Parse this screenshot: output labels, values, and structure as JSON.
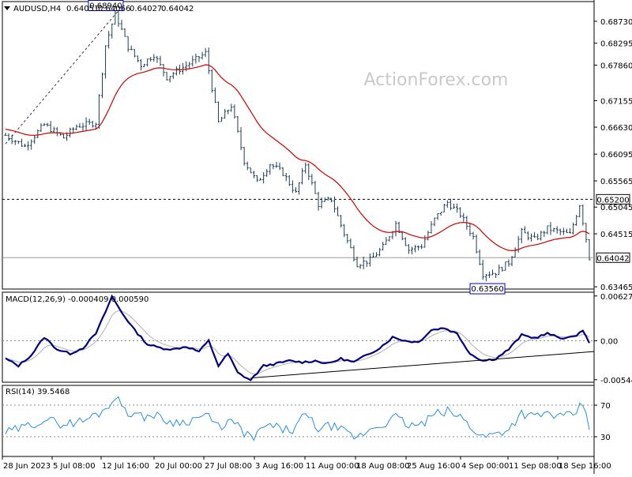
{
  "chart_data": [
    {
      "panel": "price",
      "type": "bar",
      "header": {
        "symbol": "AUDUSD,H4",
        "ohlc": [
          "0.64051",
          "0.64066",
          "0.64027",
          "0.64042"
        ]
      },
      "watermark": "ActionForex.com",
      "ylim": [
        0.6342,
        0.6912
      ],
      "yticks": [
        "0.68730",
        "0.68295",
        "0.67860",
        "0.67155",
        "0.66630",
        "0.66095",
        "0.65565",
        "0.65045",
        "0.64515",
        "0.63465"
      ],
      "ytick_values": [
        0.6873,
        0.68295,
        0.6786,
        0.67155,
        0.6663,
        0.66095,
        0.65565,
        0.65045,
        0.64515,
        0.63465
      ],
      "xlabels": [
        "28 Jun 2023",
        "5 Jul 08:00",
        "12 Jul 16:00",
        "20 Jul 00:00",
        "27 Jul 08:00",
        "3 Aug 16:00",
        "11 Aug 00:00",
        "18 Aug 08:00",
        "25 Aug 16:00",
        "4 Sep 00:00",
        "11 Sep 08:00",
        "18 Sep 16:00"
      ],
      "anchors": [
        {
          "x": 0,
          "y": 0.6647
        },
        {
          "x": 6,
          "y": 0.6625
        },
        {
          "x": 12,
          "y": 0.6668
        },
        {
          "x": 18,
          "y": 0.6642
        },
        {
          "x": 22,
          "y": 0.6665
        },
        {
          "x": 28,
          "y": 0.6672
        },
        {
          "x": 31,
          "y": 0.6825
        },
        {
          "x": 34,
          "y": 0.6889
        },
        {
          "x": 38,
          "y": 0.6822
        },
        {
          "x": 42,
          "y": 0.6786
        },
        {
          "x": 46,
          "y": 0.6807
        },
        {
          "x": 50,
          "y": 0.6762
        },
        {
          "x": 54,
          "y": 0.6778
        },
        {
          "x": 58,
          "y": 0.6793
        },
        {
          "x": 62,
          "y": 0.681
        },
        {
          "x": 66,
          "y": 0.6672
        },
        {
          "x": 70,
          "y": 0.6706
        },
        {
          "x": 74,
          "y": 0.6596
        },
        {
          "x": 78,
          "y": 0.6553
        },
        {
          "x": 82,
          "y": 0.659
        },
        {
          "x": 86,
          "y": 0.6572
        },
        {
          "x": 90,
          "y": 0.6532
        },
        {
          "x": 93,
          "y": 0.659
        },
        {
          "x": 97,
          "y": 0.651
        },
        {
          "x": 101,
          "y": 0.652
        },
        {
          "x": 105,
          "y": 0.6452
        },
        {
          "x": 109,
          "y": 0.6392
        },
        {
          "x": 113,
          "y": 0.6399
        },
        {
          "x": 117,
          "y": 0.6425
        },
        {
          "x": 121,
          "y": 0.6472
        },
        {
          "x": 125,
          "y": 0.642
        },
        {
          "x": 129,
          "y": 0.6428
        },
        {
          "x": 133,
          "y": 0.648
        },
        {
          "x": 137,
          "y": 0.6514
        },
        {
          "x": 141,
          "y": 0.649
        },
        {
          "x": 145,
          "y": 0.6445
        },
        {
          "x": 148,
          "y": 0.6372
        },
        {
          "x": 152,
          "y": 0.6375
        },
        {
          "x": 156,
          "y": 0.6395
        },
        {
          "x": 160,
          "y": 0.6455
        },
        {
          "x": 164,
          "y": 0.644
        },
        {
          "x": 168,
          "y": 0.6462
        },
        {
          "x": 172,
          "y": 0.6455
        },
        {
          "x": 175,
          "y": 0.645
        },
        {
          "x": 178,
          "y": 0.651
        },
        {
          "x": 180,
          "y": 0.6442
        },
        {
          "x": 181,
          "y": 0.6404
        }
      ],
      "ma_start": 0.666,
      "annotations": [
        {
          "label": "0.68940",
          "value": 0.6894,
          "x": 35
        },
        {
          "label": "0.63560",
          "value": 0.6356,
          "x": 145
        }
      ],
      "levels": [
        {
          "label": "0.65200",
          "value": 0.652,
          "style": "dashed"
        },
        {
          "label": "0.64042",
          "value": 0.64042,
          "style": "solid"
        }
      ],
      "trendline": {
        "from": {
          "x": 0,
          "y": 0.663
        },
        "to": {
          "x": 35,
          "y": 0.6894
        }
      }
    },
    {
      "panel": "macd",
      "type": "line",
      "title": "MACD(12,26,9) -0.000409 0.000590",
      "ylim": [
        -0.0058,
        0.0068
      ],
      "yticks": [
        "0.006275",
        "0.00",
        "-0.005446"
      ],
      "ytick_values": [
        0.006275,
        0.0,
        -0.005446
      ],
      "macd_anchors": [
        {
          "x": 0,
          "y": -0.0025
        },
        {
          "x": 4,
          "y": -0.0035
        },
        {
          "x": 8,
          "y": -0.002
        },
        {
          "x": 12,
          "y": 0.0005
        },
        {
          "x": 16,
          "y": -0.0012
        },
        {
          "x": 20,
          "y": -0.0018
        },
        {
          "x": 24,
          "y": -0.001
        },
        {
          "x": 28,
          "y": 0.001
        },
        {
          "x": 30,
          "y": 0.003
        },
        {
          "x": 33,
          "y": 0.0062
        },
        {
          "x": 36,
          "y": 0.004
        },
        {
          "x": 40,
          "y": 0.0015
        },
        {
          "x": 44,
          "y": -0.0005
        },
        {
          "x": 48,
          "y": -0.001
        },
        {
          "x": 52,
          "y": -0.0012
        },
        {
          "x": 56,
          "y": -0.0008
        },
        {
          "x": 60,
          "y": -0.0015
        },
        {
          "x": 63,
          "y": 0.0
        },
        {
          "x": 66,
          "y": -0.0035
        },
        {
          "x": 69,
          "y": -0.0018
        },
        {
          "x": 72,
          "y": -0.0045
        },
        {
          "x": 76,
          "y": -0.0055
        },
        {
          "x": 80,
          "y": -0.0035
        },
        {
          "x": 84,
          "y": -0.0032
        },
        {
          "x": 88,
          "y": -0.0028
        },
        {
          "x": 92,
          "y": -0.003
        },
        {
          "x": 96,
          "y": -0.0028
        },
        {
          "x": 100,
          "y": -0.0032
        },
        {
          "x": 104,
          "y": -0.0025
        },
        {
          "x": 108,
          "y": -0.003
        },
        {
          "x": 112,
          "y": -0.002
        },
        {
          "x": 116,
          "y": -0.001
        },
        {
          "x": 120,
          "y": 0.0005
        },
        {
          "x": 124,
          "y": 0.0
        },
        {
          "x": 128,
          "y": -0.0002
        },
        {
          "x": 132,
          "y": 0.0015
        },
        {
          "x": 136,
          "y": 0.0018
        },
        {
          "x": 140,
          "y": 0.001
        },
        {
          "x": 144,
          "y": -0.0018
        },
        {
          "x": 148,
          "y": -0.0028
        },
        {
          "x": 152,
          "y": -0.0025
        },
        {
          "x": 156,
          "y": -0.0012
        },
        {
          "x": 160,
          "y": 0.0008
        },
        {
          "x": 164,
          "y": 0.0004
        },
        {
          "x": 168,
          "y": 0.001
        },
        {
          "x": 172,
          "y": 0.0004
        },
        {
          "x": 176,
          "y": 0.0005
        },
        {
          "x": 179,
          "y": 0.0015
        },
        {
          "x": 181,
          "y": -0.0004
        }
      ],
      "signal_lag": 3,
      "trendline": {
        "from": {
          "x": 76,
          "y": -0.0052
        },
        "to": {
          "x": 181,
          "y": -0.0015
        }
      }
    },
    {
      "panel": "rsi",
      "type": "line",
      "title": "RSI(14) 39.5468",
      "ylim": [
        5,
        95
      ],
      "yticks": [
        "70",
        "30"
      ],
      "ytick_values": [
        70,
        30
      ],
      "levels": [
        70,
        30
      ],
      "rsi_anchors": [
        {
          "x": 0,
          "y": 35
        },
        {
          "x": 6,
          "y": 42
        },
        {
          "x": 12,
          "y": 52
        },
        {
          "x": 18,
          "y": 46
        },
        {
          "x": 24,
          "y": 50
        },
        {
          "x": 30,
          "y": 62
        },
        {
          "x": 34,
          "y": 80
        },
        {
          "x": 38,
          "y": 62
        },
        {
          "x": 42,
          "y": 55
        },
        {
          "x": 46,
          "y": 58
        },
        {
          "x": 50,
          "y": 50
        },
        {
          "x": 54,
          "y": 48
        },
        {
          "x": 58,
          "y": 52
        },
        {
          "x": 62,
          "y": 58
        },
        {
          "x": 66,
          "y": 42
        },
        {
          "x": 70,
          "y": 50
        },
        {
          "x": 74,
          "y": 35
        },
        {
          "x": 77,
          "y": 28
        },
        {
          "x": 81,
          "y": 45
        },
        {
          "x": 85,
          "y": 40
        },
        {
          "x": 89,
          "y": 38
        },
        {
          "x": 93,
          "y": 58
        },
        {
          "x": 97,
          "y": 40
        },
        {
          "x": 101,
          "y": 44
        },
        {
          "x": 105,
          "y": 36
        },
        {
          "x": 109,
          "y": 28
        },
        {
          "x": 113,
          "y": 40
        },
        {
          "x": 117,
          "y": 46
        },
        {
          "x": 121,
          "y": 55
        },
        {
          "x": 125,
          "y": 44
        },
        {
          "x": 129,
          "y": 45
        },
        {
          "x": 133,
          "y": 58
        },
        {
          "x": 137,
          "y": 62
        },
        {
          "x": 141,
          "y": 55
        },
        {
          "x": 145,
          "y": 40
        },
        {
          "x": 148,
          "y": 30
        },
        {
          "x": 152,
          "y": 34
        },
        {
          "x": 156,
          "y": 40
        },
        {
          "x": 160,
          "y": 60
        },
        {
          "x": 164,
          "y": 55
        },
        {
          "x": 168,
          "y": 60
        },
        {
          "x": 172,
          "y": 55
        },
        {
          "x": 176,
          "y": 57
        },
        {
          "x": 179,
          "y": 72
        },
        {
          "x": 181,
          "y": 39.5
        }
      ]
    }
  ]
}
